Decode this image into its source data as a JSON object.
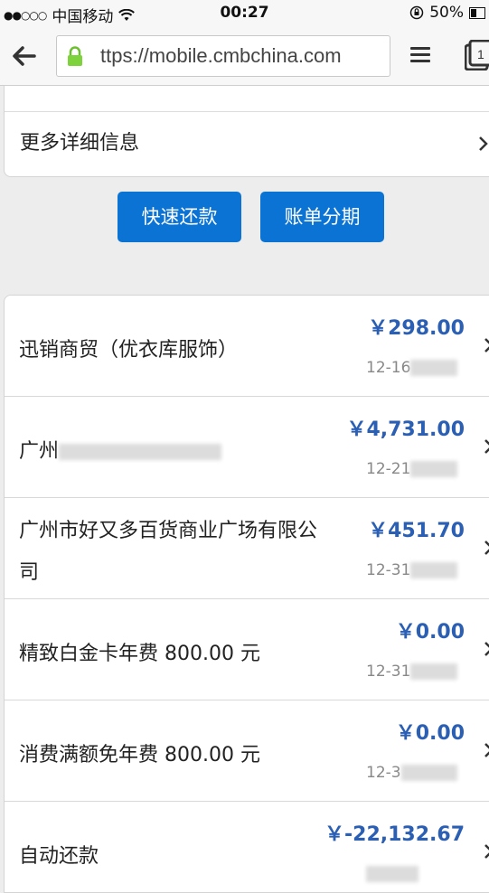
{
  "status": {
    "carrier": "中国移动",
    "time": "00:27",
    "battery": "50%"
  },
  "browser": {
    "url": "ttps://mobile.cmbchina.com"
  },
  "top_card": {
    "more_label": "更多详细信息"
  },
  "actions": {
    "quick_repay": "快速还款",
    "installment": "账单分期"
  },
  "transactions": [
    {
      "name": "迅销商贸（优衣库服饰）",
      "amount": "￥298.00",
      "date": "12-16"
    },
    {
      "name": "广州",
      "amount": "￥4,731.00",
      "date": "12-21"
    },
    {
      "name": "广州市好又多百货商业广场有限公司",
      "amount": "￥451.70",
      "date": "12-31"
    },
    {
      "name": "精致白金卡年费 800.00 元",
      "amount": "￥0.00",
      "date": "12-31"
    },
    {
      "name": "消费满额免年费 800.00 元",
      "amount": "￥0.00",
      "date": "12-3"
    },
    {
      "name": "自动还款",
      "amount": "￥-22,132.67",
      "date": ""
    }
  ]
}
